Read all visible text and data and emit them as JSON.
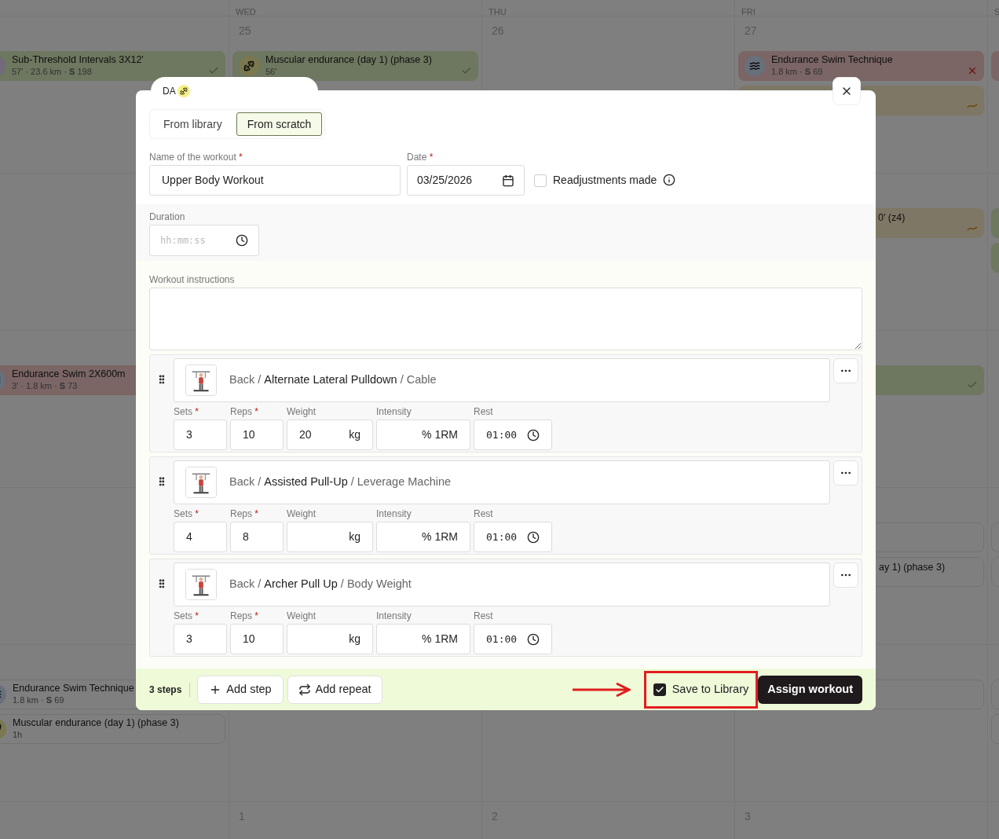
{
  "calendar": {
    "day_headers": [
      {
        "label": "WED"
      },
      {
        "label": "THU"
      },
      {
        "label": "FRI"
      },
      {
        "label": "S"
      }
    ],
    "weeks": [
      {
        "previous": {
          "events": [
            {
              "kind": "done",
              "sport": {
                "kind": "run"
              },
              "title": "Sub-Threshold Intervals 3X12'",
              "meta": "57' · 23.6 km · **S** 198"
            }
          ]
        },
        "wed": {
          "number": "25",
          "events": [
            {
              "kind": "done",
              "sport": {
                "kind": "strength"
              },
              "title": "Muscular endurance (day 1) (phase 3)",
              "meta": "56'"
            }
          ]
        },
        "thu": {
          "number": "26"
        },
        "fri": {
          "number": "27",
          "events": [
            {
              "kind": "missed",
              "sport": {
                "kind": "swim"
              },
              "title": "Endurance Swim Technique",
              "meta": "1.8 km · **S** 69"
            },
            {
              "kind": "partial"
            }
          ]
        },
        "sat": {
          "events": [
            {
              "kind": "missed"
            }
          ]
        }
      },
      {
        "fri": {
          "events": [
            {
              "kind": "partial",
              "title_end": "0' (z4)"
            }
          ]
        },
        "sat": {
          "events": [
            {
              "kind": "done"
            },
            {
              "kind": "done"
            }
          ]
        }
      },
      {
        "previous": {
          "events": [
            {
              "kind": "missed",
              "sport": {
                "kind": "swim"
              },
              "title": "Endurance Swim 2X600m",
              "meta": "3' · 1.8 km · **S** 73"
            }
          ]
        },
        "fri": {
          "events": [
            {
              "kind": "done"
            }
          ]
        }
      },
      {
        "fri": {
          "events": [
            {
              "kind": "planned"
            },
            {
              "kind": "planned",
              "title_end": "ay 1) (phase 3)"
            }
          ]
        },
        "sat": {
          "events": [
            {
              "kind": "planned"
            },
            {
              "kind": "planned"
            }
          ]
        }
      },
      {
        "previous": {
          "events": [
            {
              "kind": "planned",
              "sport": {
                "kind": "swim"
              },
              "title": "Endurance Swim Technique",
              "meta": "1.8 km · **S** 69"
            },
            {
              "kind": "planned",
              "sport": {
                "kind": "strength"
              },
              "title": "Muscular endurance (day 1) (phase 3)",
              "meta": "1h"
            }
          ]
        },
        "fri": {
          "events": [
            {
              "kind": "planned"
            }
          ]
        },
        "sat": {
          "events": [
            {
              "kind": "planned"
            },
            {
              "kind": "planned"
            }
          ]
        }
      },
      {
        "wed": {
          "number": "1"
        },
        "thu": {
          "number": "2"
        },
        "fri": {
          "number": "3"
        }
      }
    ]
  },
  "dialog": {
    "header_tab": {
      "text": "DA"
    },
    "source_tabs": [
      {
        "label": "From library",
        "selected": false
      },
      {
        "label": "From scratch",
        "selected": true
      }
    ],
    "name_field": {
      "label": "Name of the workout",
      "marker": "*",
      "value": "Upper Body Workout"
    },
    "date_field": {
      "label": "Date",
      "marker": "*",
      "value": "03/25/2026"
    },
    "readjustments": {
      "label": "Readjustments made",
      "checked": false
    },
    "duration": {
      "label": "Duration",
      "placeholder": "hh:mm:ss"
    },
    "instructions": {
      "label": "Workout instructions"
    },
    "steps": [
      {
        "title": "Back / **Alternate Lateral Pulldown** / Cable",
        "sets": {
          "label": "Sets",
          "marker": "*",
          "value": "3"
        },
        "reps": {
          "label": "Reps",
          "marker": "*",
          "value": "10"
        },
        "weight": {
          "label": "Weight",
          "value": "20",
          "unit": "kg"
        },
        "intensity": {
          "label": "Intensity",
          "unit": "% 1RM"
        },
        "rest": {
          "label": "Rest",
          "value": "01:00"
        }
      },
      {
        "title": "Back / **Assisted Pull-Up** / Leverage Machine",
        "sets": {
          "label": "Sets",
          "marker": "*",
          "value": "4"
        },
        "reps": {
          "label": "Reps",
          "marker": "*",
          "value": "8"
        },
        "weight": {
          "label": "Weight",
          "unit": "kg"
        },
        "intensity": {
          "label": "Intensity",
          "unit": "% 1RM"
        },
        "rest": {
          "label": "Rest",
          "value": "01:00"
        }
      },
      {
        "title": "Back / **Archer Pull Up** / Body Weight",
        "sets": {
          "label": "Sets",
          "marker": "*",
          "value": "3"
        },
        "reps": {
          "label": "Reps",
          "marker": "*",
          "value": "10"
        },
        "weight": {
          "label": "Weight",
          "unit": "kg"
        },
        "intensity": {
          "label": "Intensity",
          "unit": "% 1RM"
        },
        "rest": {
          "label": "Rest",
          "value": "01:00"
        }
      }
    ],
    "footer": {
      "step_count": "3 steps",
      "add_step": "Add step",
      "add_repeat": "Add repeat",
      "save_to_library": {
        "label": "Save to Library",
        "checked": true,
        "highlighted": true
      },
      "assign": "Assign workout"
    }
  }
}
